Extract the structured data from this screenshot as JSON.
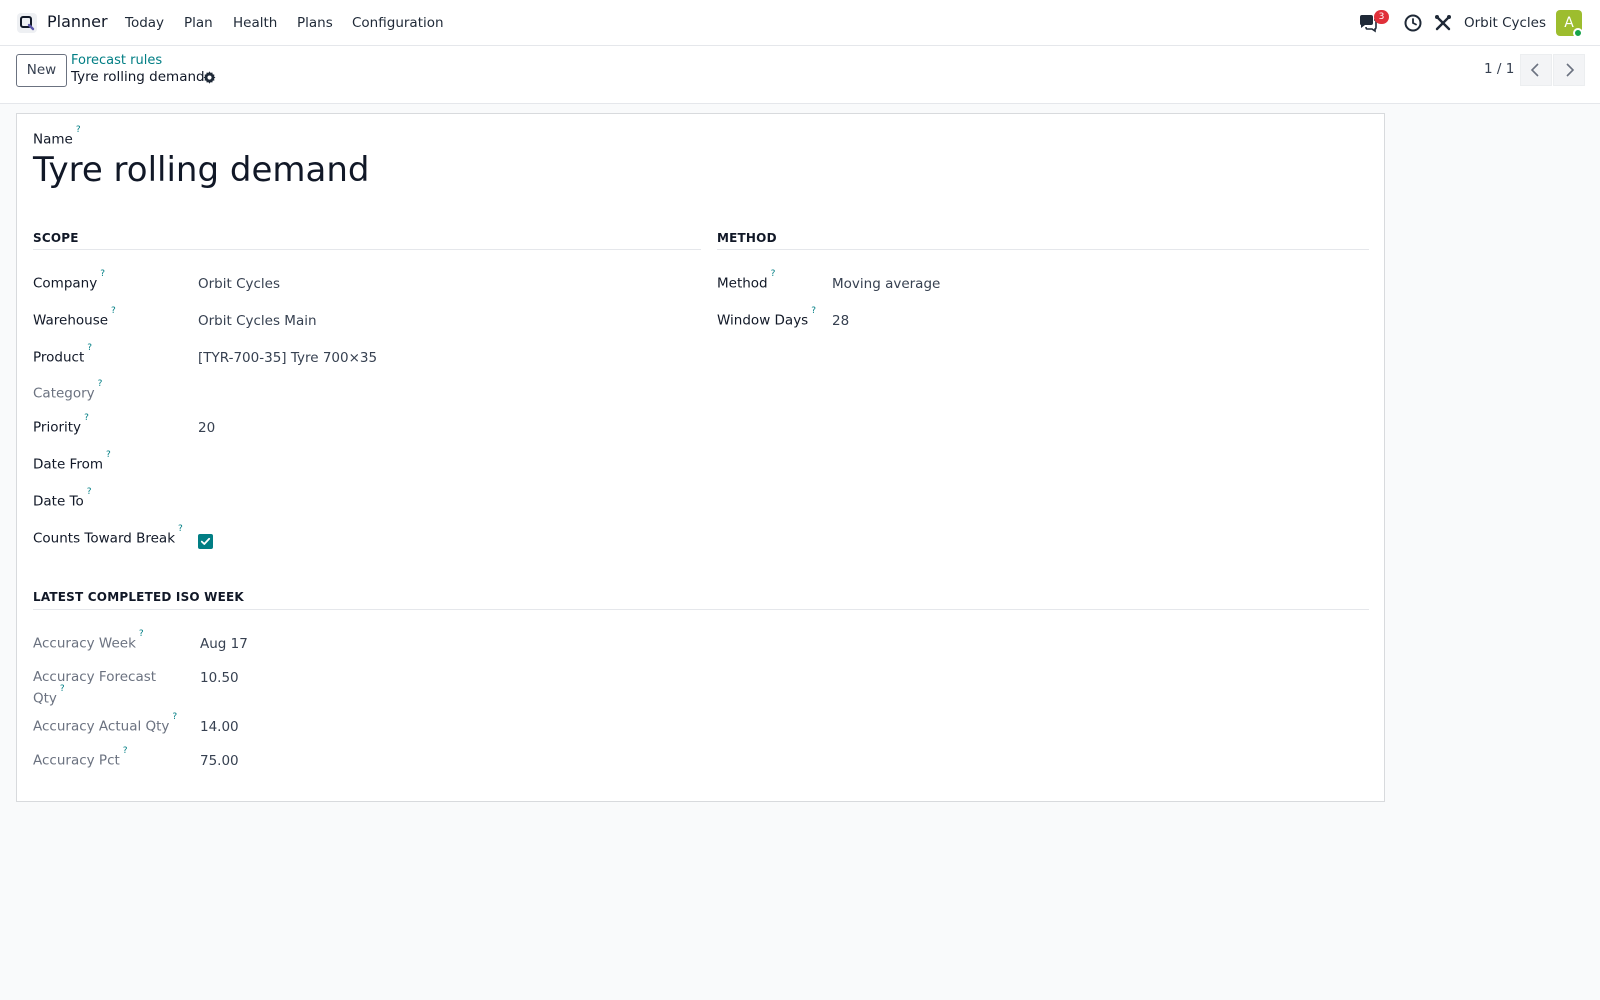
{
  "navbar": {
    "app_name": "Planner",
    "menu": [
      {
        "label": "Today"
      },
      {
        "label": "Plan"
      },
      {
        "label": "Health"
      },
      {
        "label": "Plans"
      },
      {
        "label": "Configuration"
      }
    ],
    "messages_count": "3",
    "company": "Orbit Cycles",
    "avatar_initial": "A"
  },
  "control_panel": {
    "new_label": "New",
    "breadcrumb": "Forecast rules",
    "record_title": "Tyre rolling demand",
    "pager": "1 / 1"
  },
  "form": {
    "name_label": "Name",
    "name_value": "Tyre rolling demand",
    "help_mark": "?",
    "scope": {
      "title": "SCOPE",
      "company_label": "Company",
      "company_value": "Orbit Cycles",
      "warehouse_label": "Warehouse",
      "warehouse_value": "Orbit Cycles Main",
      "product_label": "Product",
      "product_value": "[TYR-700-35] Tyre 700×35",
      "category_label": "Category",
      "category_value": "",
      "priority_label": "Priority",
      "priority_value": "20",
      "date_from_label": "Date From",
      "date_from_value": "",
      "date_to_label": "Date To",
      "date_to_value": "",
      "counts_label": "Counts Toward Break",
      "counts_checked": true
    },
    "method": {
      "title": "METHOD",
      "method_label": "Method",
      "method_value": "Moving average",
      "window_label": "Window Days",
      "window_value": "28"
    },
    "accuracy": {
      "title": "LATEST COMPLETED ISO WEEK",
      "week_label": "Accuracy Week",
      "week_value": "Aug 17",
      "forecast_label_line1": "Accuracy Forecast",
      "forecast_label_line2": "Qty",
      "forecast_value": "10.50",
      "actual_label": "Accuracy Actual Qty",
      "actual_value": "14.00",
      "pct_label": "Accuracy Pct",
      "pct_value": "75.00"
    }
  },
  "colors": {
    "accent": "#017e84",
    "badge": "#e0303a",
    "avatar": "#9dbd2e"
  }
}
